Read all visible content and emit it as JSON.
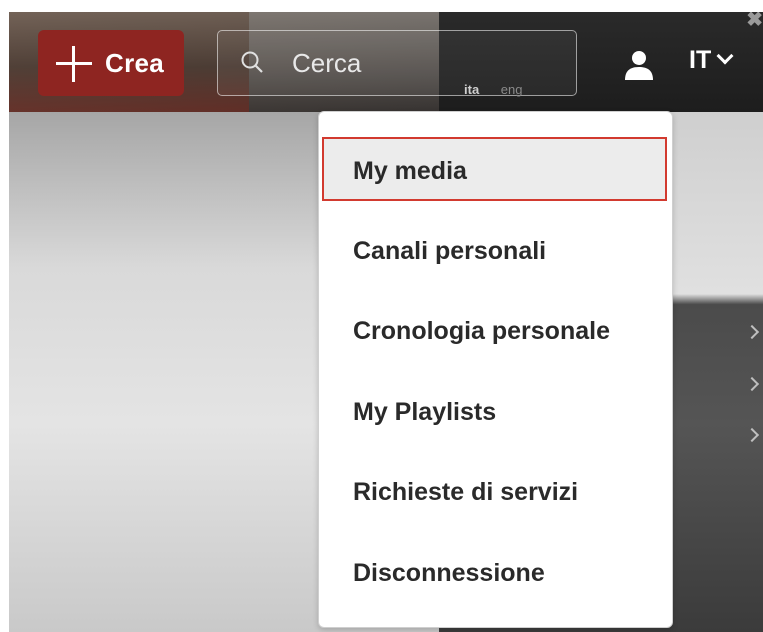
{
  "header": {
    "create_label": "Crea",
    "search_placeholder": "Cerca",
    "lang_switch": {
      "ita": "ita",
      "eng": "eng"
    },
    "language_button": "IT"
  },
  "icons": {
    "create": "plus-icon",
    "search": "search-icon",
    "user": "user-icon",
    "language_chevron": "chevron-down-icon",
    "close": "close-icon"
  },
  "dropdown": {
    "items": [
      {
        "label": "My media",
        "active": true
      },
      {
        "label": "Canali personali"
      },
      {
        "label": "Cronologia personale"
      },
      {
        "label": "My Playlists"
      },
      {
        "label": "Richieste di servizi"
      },
      {
        "label": "Disconnessione"
      }
    ]
  },
  "colors": {
    "brand_red": "#8e2521",
    "highlight_border": "#d23a2f"
  }
}
